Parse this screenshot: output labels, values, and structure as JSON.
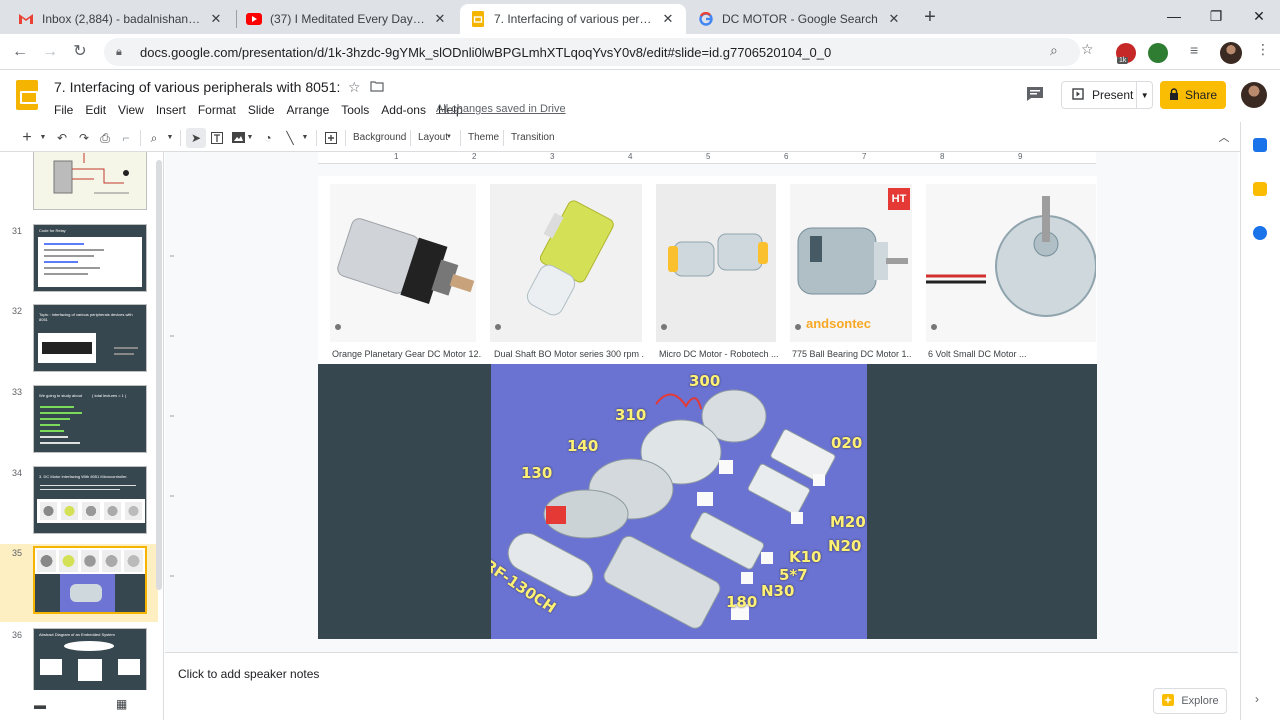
{
  "browser": {
    "tabs": [
      {
        "title": "Inbox (2,884) - badalnishant1@g",
        "icon": "gmail-icon",
        "active": false
      },
      {
        "title": "(37) I Meditated Every Day & Thi",
        "icon": "youtube-icon",
        "active": false
      },
      {
        "title": "7. Interfacing of various peripher",
        "icon": "slides-icon",
        "active": true
      },
      {
        "title": "DC MOTOR - Google Search",
        "icon": "google-icon",
        "active": false
      }
    ],
    "url": "docs.google.com/presentation/d/1k-3hzdc-9gYMk_slODnli0lwBPGLmhXTLqoqYvsY0v8/edit#slide=id.g7706520104_0_0",
    "extension_badge": "1k"
  },
  "app": {
    "doc_title": "7. Interfacing of various peripherals with 8051:",
    "menu": [
      "File",
      "Edit",
      "View",
      "Insert",
      "Format",
      "Slide",
      "Arrange",
      "Tools",
      "Add-ons",
      "Help"
    ],
    "save_status": "All changes saved in Drive",
    "present_label": "Present",
    "share_label": "Share",
    "accent_color": "#fbbc04"
  },
  "toolbar": {
    "background_label": "Background",
    "layout_label": "Layout",
    "theme_label": "Theme",
    "transition_label": "Transition"
  },
  "ruler": [
    "1",
    "2",
    "3",
    "4",
    "5",
    "6",
    "7",
    "8",
    "9"
  ],
  "filmstrip": {
    "slides": [
      {
        "number": "",
        "kind": "circuit"
      },
      {
        "number": "31",
        "kind": "code"
      },
      {
        "number": "32",
        "kind": "chip"
      },
      {
        "number": "33",
        "kind": "list"
      },
      {
        "number": "34",
        "kind": "motors"
      },
      {
        "number": "35",
        "kind": "current"
      },
      {
        "number": "36",
        "kind": "diagram"
      }
    ],
    "slide31_title": "Code for Relay",
    "slide32_title": "Topic : Interfacing of various peripherals devices with 8051",
    "slide33_title": "We going to study about",
    "slide33_subtitle": "( total lectures = 1 )",
    "slide34_title": "3. DC Motor interfacing With 8051 Microcontroller.",
    "slide36_title": "Abstract Diagram of an Embedded System"
  },
  "slide": {
    "search_results": [
      {
        "caption": "Orange Planetary Gear DC Motor 12..."
      },
      {
        "caption": "Dual Shaft BO Motor series 300 rpm ..."
      },
      {
        "caption": "Micro DC Motor - Robotech ..."
      },
      {
        "caption": "775 Ball Bearing DC Motor 1...",
        "badge": "HT",
        "watermark": "andsontec"
      },
      {
        "caption": "6 Volt Small DC Motor ..."
      }
    ],
    "motor_labels": [
      "300",
      "310",
      "140",
      "130",
      "RF-130CH",
      "020",
      "M20",
      "N20",
      "K10",
      "5*7",
      "N30",
      "180"
    ]
  },
  "notes": {
    "placeholder": "Click to add speaker notes"
  },
  "explore_label": "Explore"
}
